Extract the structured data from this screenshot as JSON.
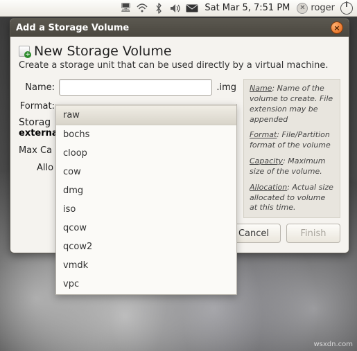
{
  "panel": {
    "datetime": "Sat Mar  5,  7:51 PM",
    "username": "roger"
  },
  "window": {
    "title": "Add a Storage Volume",
    "heading": "New Storage Volume",
    "subheading": "Create a storage unit that can be used directly by a virtual machine.",
    "name_label": "Name:",
    "name_value": "",
    "extension": ".img",
    "format_label": "Format:",
    "format_selected": "raw",
    "storage_section_title": "Storag",
    "storage_section_sub": "externa",
    "max_label": "Max Ca",
    "alloc_label": "Allo",
    "cancel_label": "Cancel",
    "finish_label": "Finish"
  },
  "help": {
    "name_term": "Name",
    "name_text": ": Name of the volume to create. File extension may be appended",
    "format_term": "Format",
    "format_text": ": File/Partition format of the volume",
    "capacity_term": "Capacity",
    "capacity_text": ": Maximum size of the volume.",
    "allocation_term": "Allocation",
    "allocation_text": ": Actual size allocated to volume at this time."
  },
  "dropdown": {
    "items": [
      "raw",
      "bochs",
      "cloop",
      "cow",
      "dmg",
      "iso",
      "qcow",
      "qcow2",
      "vmdk",
      "vpc"
    ]
  },
  "watermark": "wsxdn.com"
}
